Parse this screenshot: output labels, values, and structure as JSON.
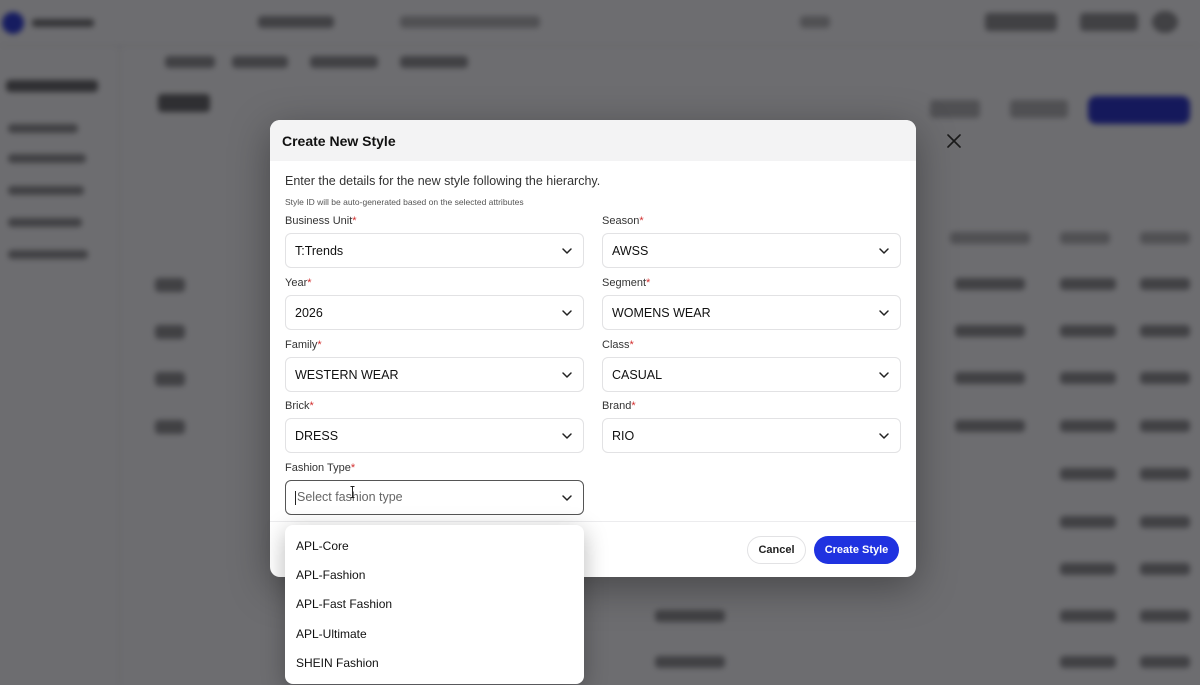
{
  "modal": {
    "title": "Create New Style",
    "description": "Enter the details for the new style following the hierarchy.",
    "hint": "Style ID will be auto-generated based on the selected attributes",
    "required_marker": "*",
    "fields": {
      "business_unit": {
        "label": "Business Unit",
        "value": "T:Trends"
      },
      "season": {
        "label": "Season",
        "value": "AWSS"
      },
      "year": {
        "label": "Year",
        "value": "2026"
      },
      "segment": {
        "label": "Segment",
        "value": "WOMENS WEAR"
      },
      "family": {
        "label": "Family",
        "value": "WESTERN WEAR"
      },
      "class": {
        "label": "Class",
        "value": "CASUAL"
      },
      "brick": {
        "label": "Brick",
        "value": "DRESS"
      },
      "brand": {
        "label": "Brand",
        "value": "RIO"
      },
      "fashion_type": {
        "label": "Fashion Type",
        "placeholder": "Select fashion type"
      }
    },
    "cancel_label": "Cancel",
    "create_label": "Create Style"
  },
  "dropdown": {
    "options": [
      "APL-Core",
      "APL-Fashion",
      "APL-Fast Fashion",
      "APL-Ultimate",
      "SHEIN Fashion"
    ]
  },
  "icons": {
    "close": "close-icon",
    "chevron": "chevron-down-icon"
  },
  "colors": {
    "primary": "#1f32e0",
    "required": "#d32f2f"
  }
}
